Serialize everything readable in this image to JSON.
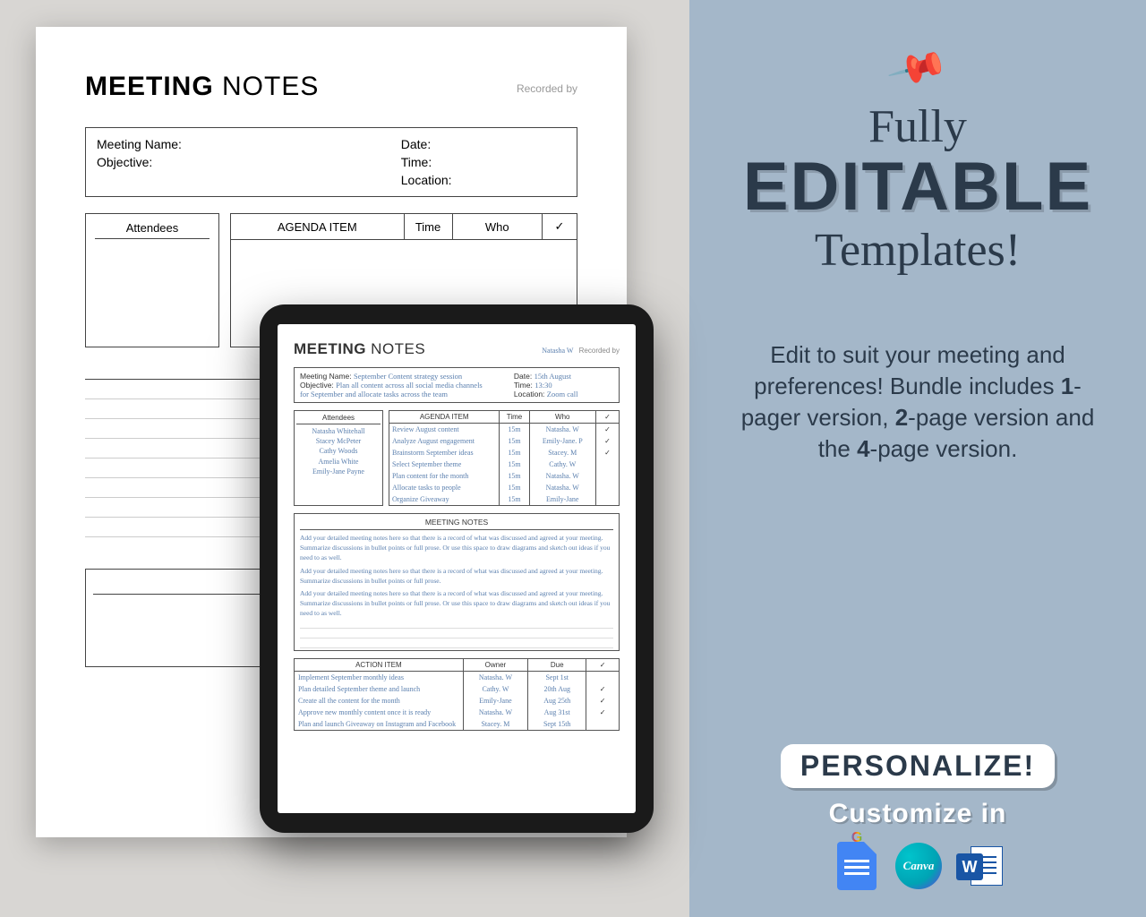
{
  "promo": {
    "headline_l1": "Fully",
    "headline_l2": "EDITABLE",
    "headline_l3": "Templates!",
    "description_pre": "Edit to suit your meeting and preferences! Bundle includes ",
    "description_b1": "1",
    "description_mid1": "-pager version, ",
    "description_b2": "2",
    "description_mid2": "-page version and the ",
    "description_b3": "4",
    "description_end": "-page version.",
    "personalize": "PERSONALIZE!",
    "customize": "Customize in",
    "gdocs_g": "G",
    "canva_label": "Canva",
    "word_label": "W"
  },
  "page": {
    "title_bold": "MEETING",
    "title_thin": " NOTES",
    "recorded_by": "Recorded by",
    "meta": {
      "meeting_name": "Meeting Name:",
      "objective": "Objective:",
      "date": "Date:",
      "time": "Time:",
      "location": "Location:"
    },
    "attendees_hd": "Attendees",
    "agenda_hd": "AGENDA ITEM",
    "agenda_time": "Time",
    "agenda_who": "Who",
    "agenda_check": "✓",
    "action_hd": "ACTION ITEM"
  },
  "tablet": {
    "title_bold": "MEETING",
    "title_thin": " NOTES",
    "recorder_name": "Natasha W",
    "recorded_by": "Recorded by",
    "meta": {
      "meeting_name_lab": "Meeting Name:",
      "meeting_name_val": "September Content strategy session",
      "objective_lab": "Objective:",
      "objective_val": "Plan all content across all social media channels",
      "objective_val2": "for September and allocate tasks across the team",
      "date_lab": "Date:",
      "date_val": "15th August",
      "time_lab": "Time:",
      "time_val": "13:30",
      "location_lab": "Location:",
      "location_val": "Zoom call"
    },
    "attendees_hd": "Attendees",
    "attendees": [
      "Natasha Whitehall",
      "Stacey McPeter",
      "Cathy Woods",
      "Amelia White",
      "Emily-Jane Payne"
    ],
    "agenda_hd": "AGENDA ITEM",
    "agenda_time": "Time",
    "agenda_who": "Who",
    "agenda_check": "✓",
    "agenda": [
      {
        "item": "Review August content",
        "time": "15m",
        "who": "Natasha. W",
        "chk": "✓"
      },
      {
        "item": "Analyze August engagement",
        "time": "15m",
        "who": "Emily-Jane. P",
        "chk": "✓"
      },
      {
        "item": "Brainstorm September ideas",
        "time": "15m",
        "who": "Stacey. M",
        "chk": "✓"
      },
      {
        "item": "Select September theme",
        "time": "15m",
        "who": "Cathy. W",
        "chk": ""
      },
      {
        "item": "Plan content for the month",
        "time": "15m",
        "who": "Natasha. W",
        "chk": ""
      },
      {
        "item": "Allocate tasks to people",
        "time": "15m",
        "who": "Natasha. W",
        "chk": ""
      },
      {
        "item": "Organize Giveaway",
        "time": "15m",
        "who": "Emily-Jane",
        "chk": ""
      }
    ],
    "notes_hd": "MEETING NOTES",
    "notes": [
      "Add your detailed meeting notes here so that there is a record of what was discussed and agreed at your meeting. Summarize discussions in bullet points or full prose. Or use this space to draw diagrams and sketch out ideas if you need to as well.",
      "Add your detailed meeting notes here so that there is a record of what was discussed and agreed at your meeting. Summarize discussions in bullet points or full prose.",
      "Add your detailed meeting notes here so that there is a record of what was discussed and agreed at your meeting. Summarize discussions in bullet points or full prose. Or use this space to draw diagrams and sketch out ideas if you need to as well."
    ],
    "action_hd": "ACTION ITEM",
    "action_owner": "Owner",
    "action_due": "Due",
    "action_check": "✓",
    "actions": [
      {
        "item": "Implement September monthly ideas",
        "owner": "Natasha. W",
        "due": "Sept 1st",
        "chk": ""
      },
      {
        "item": "Plan detailed September theme and launch",
        "owner": "Cathy. W",
        "due": "20th Aug",
        "chk": "✓"
      },
      {
        "item": "Create all the content for the month",
        "owner": "Emily-Jane",
        "due": "Aug 25th",
        "chk": "✓"
      },
      {
        "item": "Approve new monthly content once it is ready",
        "owner": "Natasha. W",
        "due": "Aug 31st",
        "chk": "✓"
      },
      {
        "item": "Plan and launch Giveaway on Instagram and Facebook",
        "owner": "Stacey. M",
        "due": "Sept 15th",
        "chk": ""
      }
    ]
  }
}
